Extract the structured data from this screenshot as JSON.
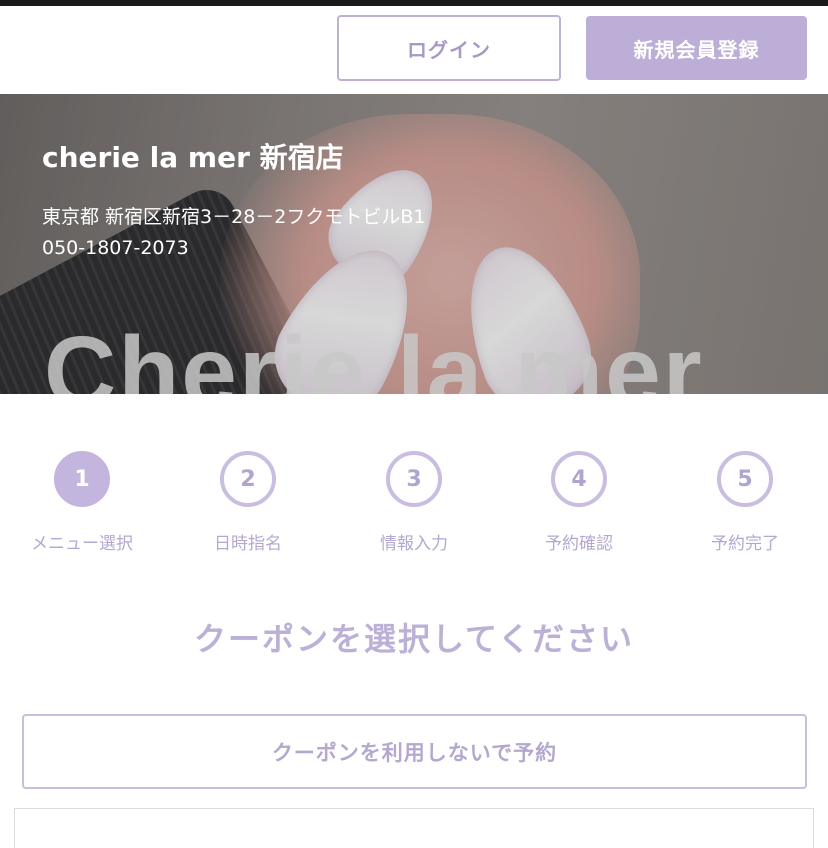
{
  "header": {
    "login_label": "ログイン",
    "register_label": "新規会員登録"
  },
  "hero": {
    "salon_name": "cherie la mer 新宿店",
    "address": "東京都 新宿区新宿3－28－2フクモトビルB1",
    "phone": "050-1807-2073",
    "image_text": "Cherie la mer"
  },
  "steps": [
    {
      "number": "1",
      "label": "メニュー選択",
      "active": true
    },
    {
      "number": "2",
      "label": "日時指名",
      "active": false
    },
    {
      "number": "3",
      "label": "情報入力",
      "active": false
    },
    {
      "number": "4",
      "label": "予約確認",
      "active": false
    },
    {
      "number": "5",
      "label": "予約完了",
      "active": false
    }
  ],
  "coupon": {
    "title": "クーポンを選択してください",
    "no_coupon_label": "クーポンを利用しないで予約"
  },
  "colors": {
    "accent": "#bcaed6",
    "accent_text": "#b4a8cf",
    "border": "#c8bedd"
  }
}
